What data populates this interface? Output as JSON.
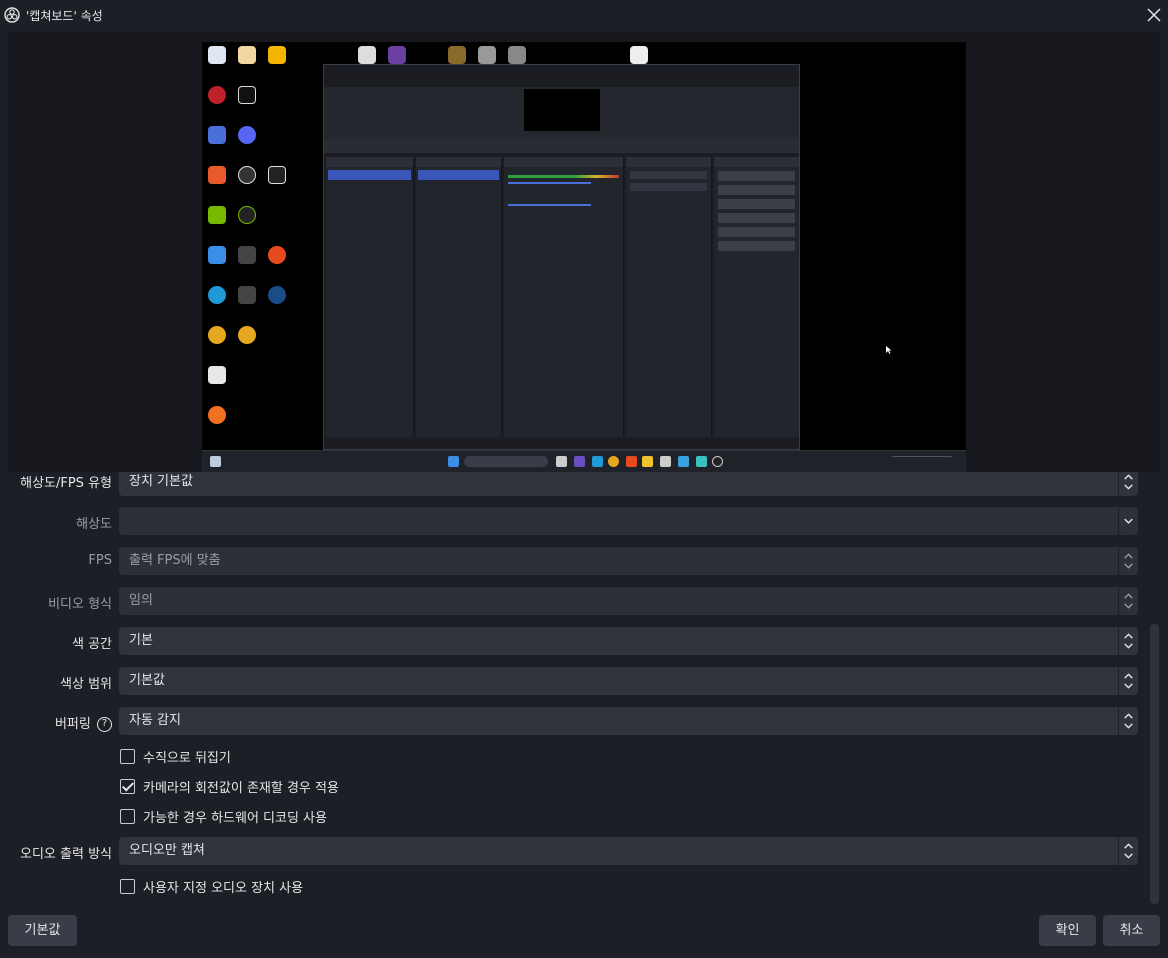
{
  "window": {
    "title": "'캡쳐보드' 속성",
    "logo_icon": "obs-logo-icon",
    "close_icon": "close-icon"
  },
  "form": {
    "rows": [
      {
        "label": "해상도/FPS 유형",
        "value": "장치 기본값",
        "dim": false
      },
      {
        "label": "해상도",
        "value": "",
        "dim": true
      },
      {
        "label": "FPS",
        "value": "출력 FPS에 맞춤",
        "dim": true
      },
      {
        "label": "비디오 형식",
        "value": "임의",
        "dim": true
      },
      {
        "label": "색 공간",
        "value": "기본",
        "dim": false
      },
      {
        "label": "색상 범위",
        "value": "기본값",
        "dim": false
      },
      {
        "label": "버퍼링",
        "value": "자동 감지",
        "dim": false
      }
    ],
    "checkboxes": [
      {
        "label": "수직으로 뒤집기",
        "checked": false
      },
      {
        "label": "카메라의 회전값이 존재할 경우 적용",
        "checked": true
      },
      {
        "label": "가능한 경우 하드웨어 디코딩 사용",
        "checked": false
      }
    ],
    "audio_output": {
      "label": "오디오 출력 방식",
      "value": "오디오만 캡쳐"
    },
    "custom_audio": {
      "label": "사용자 지정 오디오 장치 사용",
      "checked": false
    }
  },
  "buttons": {
    "defaults": "기본값",
    "ok": "확인",
    "cancel": "취소"
  },
  "colors": {
    "background": "#1d1f26",
    "combo": "#30333c",
    "button": "#3a3d47",
    "selected": "#3a56b8"
  }
}
